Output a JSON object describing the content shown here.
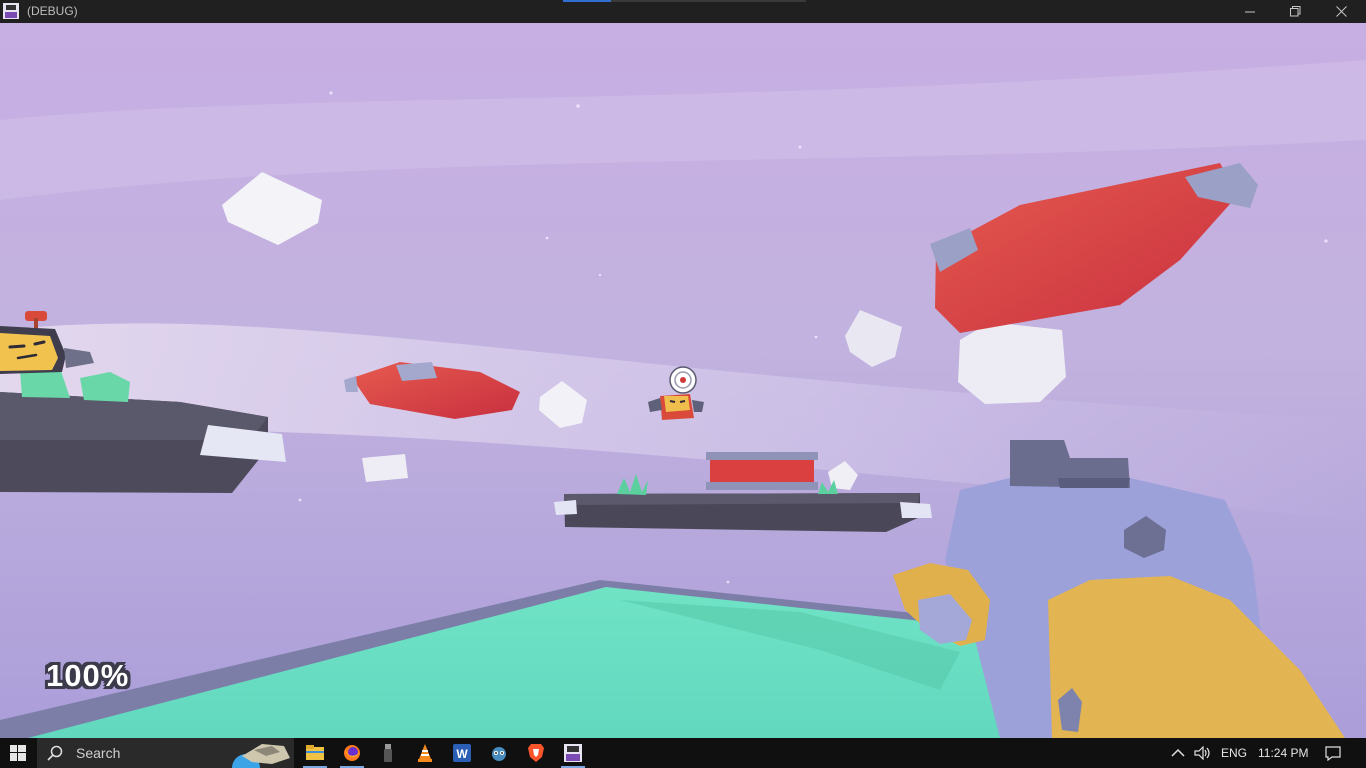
{
  "window": {
    "title": "(DEBUG)"
  },
  "hud": {
    "health": "100%"
  },
  "taskbar": {
    "search_placeholder": "Search",
    "language": "ENG",
    "time": "11:24 PM",
    "apps": [
      "file-explorer",
      "firefox",
      "usb-tool",
      "vlc",
      "word",
      "godot",
      "brave",
      "game-debug"
    ]
  },
  "colors": {
    "sky_top": "#c3a9e0",
    "sky_bottom": "#a89ad8",
    "platform_teal": "#6fe0c4",
    "platform_dark": "#4a4858",
    "crate_red": "#d94145",
    "gun_body": "#9aa0d8",
    "gun_accent": "#e0b24e"
  }
}
